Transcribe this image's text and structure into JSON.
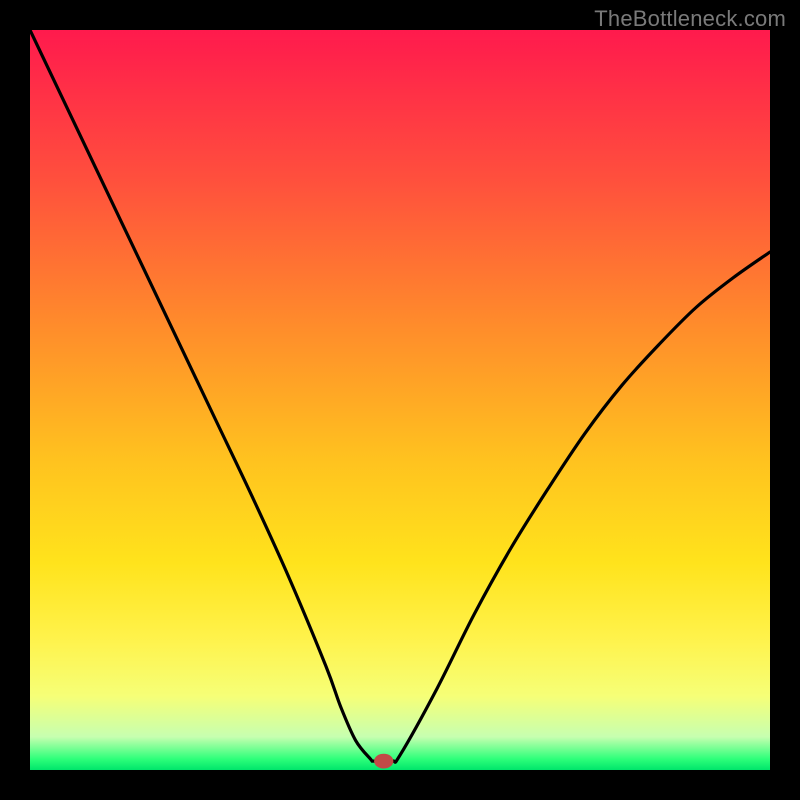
{
  "watermark": "TheBottleneck.com",
  "chart_data": {
    "type": "line",
    "title": "",
    "xlabel": "",
    "ylabel": "",
    "xlim": [
      0,
      100
    ],
    "ylim": [
      0,
      100
    ],
    "grid": false,
    "series": [
      {
        "name": "curve",
        "x": [
          0,
          5,
          10,
          15,
          20,
          25,
          30,
          35,
          40,
          42,
          44,
          46,
          46.5,
          49,
          50,
          55,
          60,
          65,
          70,
          75,
          80,
          85,
          90,
          95,
          100
        ],
        "y": [
          100,
          89.5,
          79,
          68.5,
          58,
          47.5,
          37,
          26,
          14,
          8.5,
          4,
          1.5,
          1.2,
          1.2,
          2,
          11,
          21,
          30,
          38,
          45.5,
          52,
          57.5,
          62.5,
          66.5,
          70
        ]
      }
    ],
    "gradient_stops": [
      {
        "offset": 0.0,
        "color": "#ff1a4d"
      },
      {
        "offset": 0.2,
        "color": "#ff4f3d"
      },
      {
        "offset": 0.4,
        "color": "#ff8c2b"
      },
      {
        "offset": 0.58,
        "color": "#ffc21f"
      },
      {
        "offset": 0.72,
        "color": "#ffe31c"
      },
      {
        "offset": 0.82,
        "color": "#fff24a"
      },
      {
        "offset": 0.9,
        "color": "#f6ff77"
      },
      {
        "offset": 0.955,
        "color": "#c7ffb0"
      },
      {
        "offset": 0.985,
        "color": "#2eff7a"
      },
      {
        "offset": 1.0,
        "color": "#00e56b"
      }
    ],
    "marker": {
      "x": 47.8,
      "y": 1.2,
      "rx": 1.3,
      "ry": 1.0,
      "color": "#c24a47"
    }
  }
}
